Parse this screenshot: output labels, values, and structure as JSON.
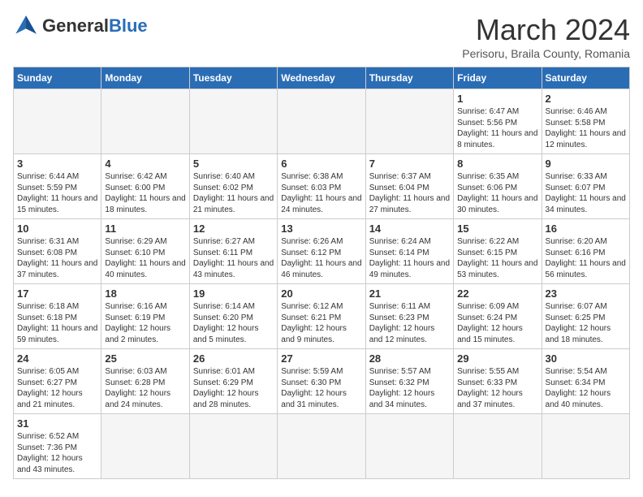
{
  "header": {
    "logo_general": "General",
    "logo_blue": "Blue",
    "month_title": "March 2024",
    "location": "Perisoru, Braila County, Romania"
  },
  "days_of_week": [
    "Sunday",
    "Monday",
    "Tuesday",
    "Wednesday",
    "Thursday",
    "Friday",
    "Saturday"
  ],
  "weeks": [
    [
      {
        "day": "",
        "info": ""
      },
      {
        "day": "",
        "info": ""
      },
      {
        "day": "",
        "info": ""
      },
      {
        "day": "",
        "info": ""
      },
      {
        "day": "",
        "info": ""
      },
      {
        "day": "1",
        "info": "Sunrise: 6:47 AM\nSunset: 5:56 PM\nDaylight: 11 hours and 8 minutes."
      },
      {
        "day": "2",
        "info": "Sunrise: 6:46 AM\nSunset: 5:58 PM\nDaylight: 11 hours and 12 minutes."
      }
    ],
    [
      {
        "day": "3",
        "info": "Sunrise: 6:44 AM\nSunset: 5:59 PM\nDaylight: 11 hours and 15 minutes."
      },
      {
        "day": "4",
        "info": "Sunrise: 6:42 AM\nSunset: 6:00 PM\nDaylight: 11 hours and 18 minutes."
      },
      {
        "day": "5",
        "info": "Sunrise: 6:40 AM\nSunset: 6:02 PM\nDaylight: 11 hours and 21 minutes."
      },
      {
        "day": "6",
        "info": "Sunrise: 6:38 AM\nSunset: 6:03 PM\nDaylight: 11 hours and 24 minutes."
      },
      {
        "day": "7",
        "info": "Sunrise: 6:37 AM\nSunset: 6:04 PM\nDaylight: 11 hours and 27 minutes."
      },
      {
        "day": "8",
        "info": "Sunrise: 6:35 AM\nSunset: 6:06 PM\nDaylight: 11 hours and 30 minutes."
      },
      {
        "day": "9",
        "info": "Sunrise: 6:33 AM\nSunset: 6:07 PM\nDaylight: 11 hours and 34 minutes."
      }
    ],
    [
      {
        "day": "10",
        "info": "Sunrise: 6:31 AM\nSunset: 6:08 PM\nDaylight: 11 hours and 37 minutes."
      },
      {
        "day": "11",
        "info": "Sunrise: 6:29 AM\nSunset: 6:10 PM\nDaylight: 11 hours and 40 minutes."
      },
      {
        "day": "12",
        "info": "Sunrise: 6:27 AM\nSunset: 6:11 PM\nDaylight: 11 hours and 43 minutes."
      },
      {
        "day": "13",
        "info": "Sunrise: 6:26 AM\nSunset: 6:12 PM\nDaylight: 11 hours and 46 minutes."
      },
      {
        "day": "14",
        "info": "Sunrise: 6:24 AM\nSunset: 6:14 PM\nDaylight: 11 hours and 49 minutes."
      },
      {
        "day": "15",
        "info": "Sunrise: 6:22 AM\nSunset: 6:15 PM\nDaylight: 11 hours and 53 minutes."
      },
      {
        "day": "16",
        "info": "Sunrise: 6:20 AM\nSunset: 6:16 PM\nDaylight: 11 hours and 56 minutes."
      }
    ],
    [
      {
        "day": "17",
        "info": "Sunrise: 6:18 AM\nSunset: 6:18 PM\nDaylight: 11 hours and 59 minutes."
      },
      {
        "day": "18",
        "info": "Sunrise: 6:16 AM\nSunset: 6:19 PM\nDaylight: 12 hours and 2 minutes."
      },
      {
        "day": "19",
        "info": "Sunrise: 6:14 AM\nSunset: 6:20 PM\nDaylight: 12 hours and 5 minutes."
      },
      {
        "day": "20",
        "info": "Sunrise: 6:12 AM\nSunset: 6:21 PM\nDaylight: 12 hours and 9 minutes."
      },
      {
        "day": "21",
        "info": "Sunrise: 6:11 AM\nSunset: 6:23 PM\nDaylight: 12 hours and 12 minutes."
      },
      {
        "day": "22",
        "info": "Sunrise: 6:09 AM\nSunset: 6:24 PM\nDaylight: 12 hours and 15 minutes."
      },
      {
        "day": "23",
        "info": "Sunrise: 6:07 AM\nSunset: 6:25 PM\nDaylight: 12 hours and 18 minutes."
      }
    ],
    [
      {
        "day": "24",
        "info": "Sunrise: 6:05 AM\nSunset: 6:27 PM\nDaylight: 12 hours and 21 minutes."
      },
      {
        "day": "25",
        "info": "Sunrise: 6:03 AM\nSunset: 6:28 PM\nDaylight: 12 hours and 24 minutes."
      },
      {
        "day": "26",
        "info": "Sunrise: 6:01 AM\nSunset: 6:29 PM\nDaylight: 12 hours and 28 minutes."
      },
      {
        "day": "27",
        "info": "Sunrise: 5:59 AM\nSunset: 6:30 PM\nDaylight: 12 hours and 31 minutes."
      },
      {
        "day": "28",
        "info": "Sunrise: 5:57 AM\nSunset: 6:32 PM\nDaylight: 12 hours and 34 minutes."
      },
      {
        "day": "29",
        "info": "Sunrise: 5:55 AM\nSunset: 6:33 PM\nDaylight: 12 hours and 37 minutes."
      },
      {
        "day": "30",
        "info": "Sunrise: 5:54 AM\nSunset: 6:34 PM\nDaylight: 12 hours and 40 minutes."
      }
    ],
    [
      {
        "day": "31",
        "info": "Sunrise: 6:52 AM\nSunset: 7:36 PM\nDaylight: 12 hours and 43 minutes."
      },
      {
        "day": "",
        "info": ""
      },
      {
        "day": "",
        "info": ""
      },
      {
        "day": "",
        "info": ""
      },
      {
        "day": "",
        "info": ""
      },
      {
        "day": "",
        "info": ""
      },
      {
        "day": "",
        "info": ""
      }
    ]
  ]
}
